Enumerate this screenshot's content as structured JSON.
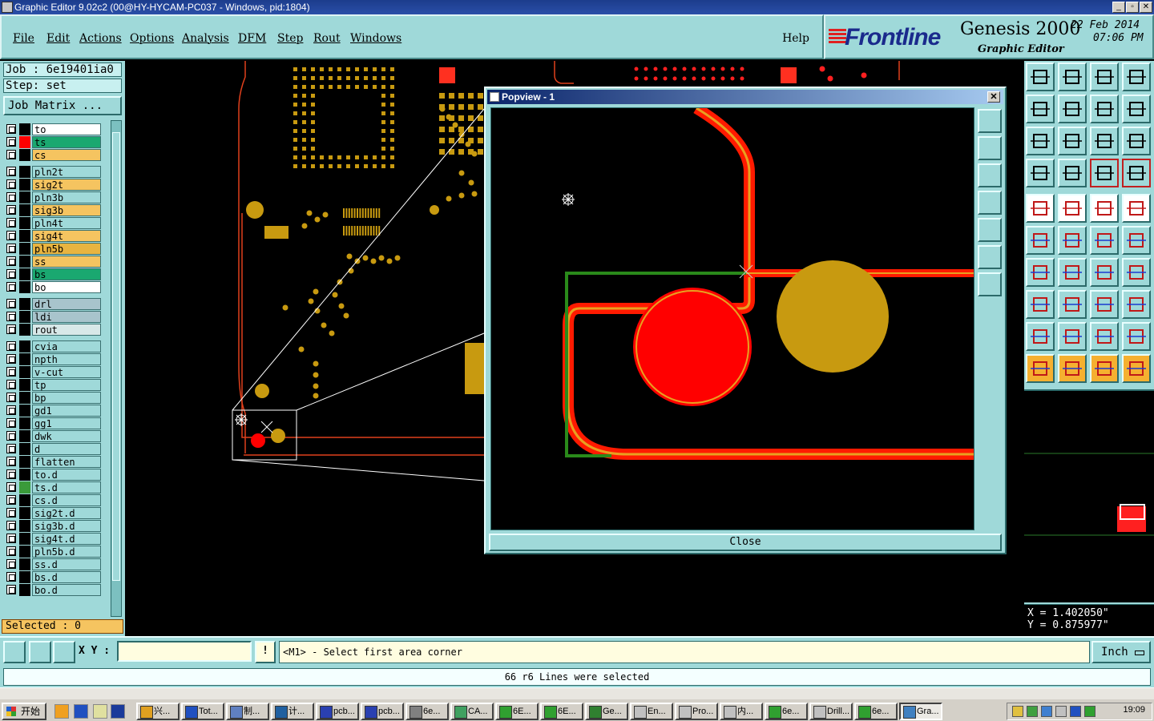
{
  "window": {
    "title": "Graphic Editor 9.02c2 (00@HY-HYCAM-PC037 - Windows, pid:1804)"
  },
  "menu": {
    "items": [
      "File",
      "Edit",
      "Actions",
      "Options",
      "Analysis",
      "DFM",
      "Step",
      "Rout",
      "Windows"
    ],
    "help": "Help"
  },
  "brand": {
    "logo": "Frontline",
    "product": "Genesis 2000",
    "subtitle": "Graphic Editor",
    "date": "22 Feb 2014",
    "time": "07:06 PM"
  },
  "left": {
    "job": "Job : 6e19401ia0",
    "step": "Step: set",
    "job_matrix": "Job Matrix ...",
    "selected": "Selected : 0",
    "layers": [
      {
        "name": "to",
        "bg": "#ffffff",
        "sw": "#000000"
      },
      {
        "name": "ts",
        "bg": "#1aa870",
        "sw": "#ff0000",
        "mk": "⊞"
      },
      {
        "name": "cs",
        "bg": "#f5c460",
        "sw": "#000000"
      },
      {
        "name": "pln2t",
        "bg": "#9fd9d9",
        "sw": "#000000"
      },
      {
        "name": "sig2t",
        "bg": "#f5c460",
        "sw": "#000000"
      },
      {
        "name": "pln3b",
        "bg": "#9fd9d9",
        "sw": "#000000"
      },
      {
        "name": "sig3b",
        "bg": "#f5c460",
        "sw": "#000000"
      },
      {
        "name": "pln4t",
        "bg": "#9fd9d9",
        "sw": "#000000"
      },
      {
        "name": "sig4t",
        "bg": "#f5c460",
        "sw": "#000000"
      },
      {
        "name": "pln5b",
        "bg": "#e8b440",
        "sw": "#000000"
      },
      {
        "name": "ss",
        "bg": "#f5c460",
        "sw": "#000000"
      },
      {
        "name": "bs",
        "bg": "#1aa870",
        "sw": "#000000"
      },
      {
        "name": "bo",
        "bg": "#ffffff",
        "sw": "#000000"
      },
      {
        "name": "drl",
        "bg": "#a8c4cc",
        "sw": "#000000"
      },
      {
        "name": "ldi",
        "bg": "#a8c4cc",
        "sw": "#000000"
      },
      {
        "name": "rout",
        "bg": "#d8e8e8",
        "sw": "#000000"
      },
      {
        "name": "cvia",
        "bg": "#9fd9d9",
        "sw": "#000000"
      },
      {
        "name": "npth",
        "bg": "#9fd9d9",
        "sw": "#000000"
      },
      {
        "name": "v-cut",
        "bg": "#9fd9d9",
        "sw": "#000000"
      },
      {
        "name": "tp",
        "bg": "#9fd9d9",
        "sw": "#000000"
      },
      {
        "name": "bp",
        "bg": "#9fd9d9",
        "sw": "#000000"
      },
      {
        "name": "gd1",
        "bg": "#9fd9d9",
        "sw": "#000000"
      },
      {
        "name": "gg1",
        "bg": "#9fd9d9",
        "sw": "#000000"
      },
      {
        "name": "dwk",
        "bg": "#9fd9d9",
        "sw": "#000000"
      },
      {
        "name": "d",
        "bg": "#9fd9d9",
        "sw": "#000000"
      },
      {
        "name": "flatten",
        "bg": "#9fd9d9",
        "sw": "#000000"
      },
      {
        "name": "to.d",
        "bg": "#9fd9d9",
        "sw": "#000000",
        "mk": "⬋"
      },
      {
        "name": "ts.d",
        "bg": "#9fd9d9",
        "sw": "#3a9a3a",
        "mk": "⬋"
      },
      {
        "name": "cs.d",
        "bg": "#9fd9d9",
        "sw": "#000000",
        "mk": "⬋"
      },
      {
        "name": "sig2t.d",
        "bg": "#9fd9d9",
        "sw": "#000000",
        "mk": "⬋"
      },
      {
        "name": "sig3b.d",
        "bg": "#9fd9d9",
        "sw": "#000000",
        "mk": "⬋"
      },
      {
        "name": "sig4t.d",
        "bg": "#9fd9d9",
        "sw": "#000000",
        "mk": "⬋"
      },
      {
        "name": "pln5b.d",
        "bg": "#9fd9d9",
        "sw": "#000000",
        "mk": "⬋"
      },
      {
        "name": "ss.d",
        "bg": "#9fd9d9",
        "sw": "#000000",
        "mk": "⬋"
      },
      {
        "name": "bs.d",
        "bg": "#9fd9d9",
        "sw": "#000000",
        "mk": "⬋"
      },
      {
        "name": "bo.d",
        "bg": "#9fd9d9",
        "sw": "#000000",
        "mk": "⬋"
      }
    ]
  },
  "popview": {
    "title": "Popview - 1",
    "close_label": "Close"
  },
  "coords": {
    "x": "X = 1.402050\"",
    "y": "Y = 0.875977\""
  },
  "bottom": {
    "xy_label": "X Y :",
    "xy_value": "",
    "prompt": "<M1> - Select first area corner",
    "units": "Inch",
    "status": "66 r6 Lines were selected"
  },
  "taskbar": {
    "start": "开始",
    "tasks": [
      "兴...",
      "Tot...",
      "制...",
      "计...",
      "pcb...",
      "pcb...",
      "6e...",
      "CA...",
      "6E...",
      "6E...",
      "Ge...",
      "En...",
      "Pro...",
      "内...",
      "6e...",
      "Drill...",
      "6e...",
      "Gra..."
    ],
    "clock": "19:09"
  }
}
